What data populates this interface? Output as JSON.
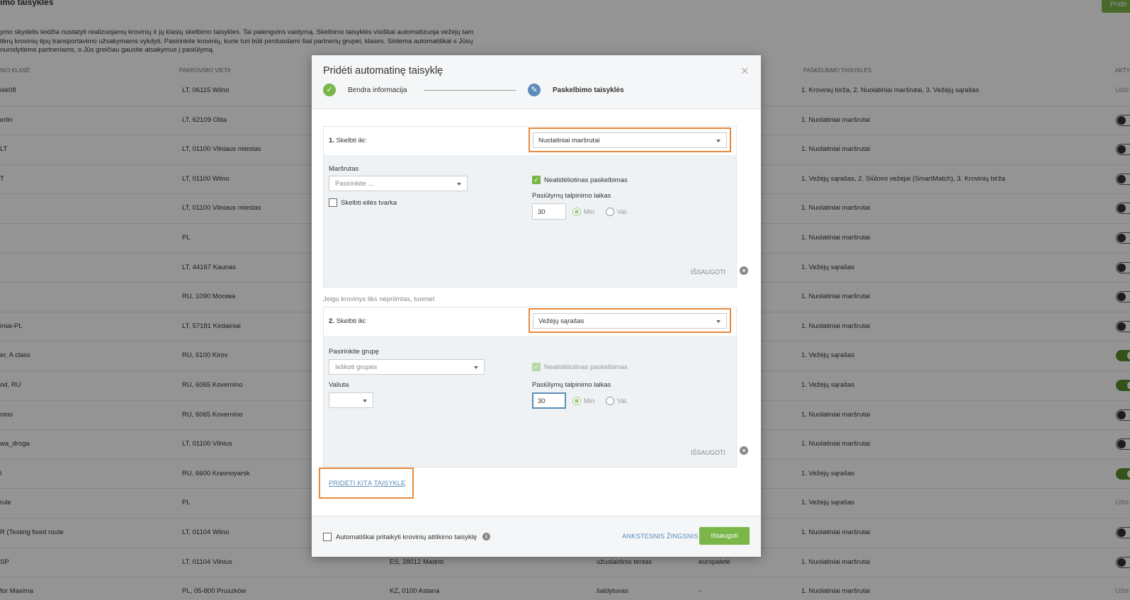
{
  "background": {
    "title": "imo taisyklės",
    "add_button": "Pridė",
    "description": "ymo skydelis leidžia nustatyti realizuojamų krovinių ir jų klasių skelbimo taisykles. Tai palengvins vaidymą. Skelbimo taisyklės visiškai automatizuoja vežėjų tam tikrų krovinių tipų transportavimo užsakymams vykdyti. Pasirinkite krovinių, kurie turi būti perduodami šiai partnerių grupei, klases. Sistema automatiškai s Jūsų nurodytiems partneriams, o Jūs greičiau gausite atsakymus į pasiūlymą.",
    "headers": {
      "class": "NIO KLASĖ",
      "loading": "PAKROVIMO VIETA",
      "rules": "PASKELBIMO TAISYKLĖS",
      "active": "AKTY"
    },
    "rows": [
      {
        "name": "iek08",
        "loading": "LT, 06115 Wilno",
        "unloading": "",
        "type": "",
        "pack": "",
        "rules": "1. Krovinių birža, 2. Nuolatiniai maršrutai, 3. Vežėjų sąrašas",
        "status": "Užbl"
      },
      {
        "name": "erlin",
        "loading": "LT, 62109 Olita",
        "unloading": "",
        "type": "",
        "pack": "",
        "rules": "1. Nuolatiniai maršrutai",
        "status": "toggle-off"
      },
      {
        "name": "LT",
        "loading": "LT, 01100 Vilniaus miestas",
        "unloading": "",
        "type": "",
        "pack": "",
        "rules": "1. Nuolatiniai maršrutai",
        "status": "toggle-off"
      },
      {
        "name": "T",
        "loading": "LT, 01100 Wilno",
        "unloading": "",
        "type": "",
        "pack": "",
        "rules": "1. Vežėjų sąrašas, 2. Siūlomi vežėjai (SmartMatch), 3. Krovinių birža",
        "status": "toggle-off"
      },
      {
        "name": "",
        "loading": "LT, 01100 Vilniaus miestas",
        "unloading": "",
        "type": "",
        "pack": "",
        "rules": "1. Nuolatiniai maršrutai",
        "status": "toggle-off"
      },
      {
        "name": "",
        "loading": "PL",
        "unloading": "",
        "type": "",
        "pack": "",
        "rules": "1. Nuolatiniai maršrutai",
        "status": "toggle-off"
      },
      {
        "name": "",
        "loading": "LT, 44167 Kaunas",
        "unloading": "",
        "type": "",
        "pack": "",
        "rules": "1. Vežėjų sąrašas",
        "status": "toggle-off"
      },
      {
        "name": "",
        "loading": "RU, 1090 Москва",
        "unloading": "",
        "type": "",
        "pack": "",
        "rules": "1. Nuolatiniai maršrutai",
        "status": "toggle-off"
      },
      {
        "name": "iniai-PL",
        "loading": "LT, 57181 Kėdainiai",
        "unloading": "",
        "type": "",
        "pack": "",
        "rules": "1. Nuolatiniai maršrutai",
        "status": "toggle-off"
      },
      {
        "name": "er, A class",
        "loading": "RU, 6100 Kirov",
        "unloading": "",
        "type": "",
        "pack": "",
        "rules": "1. Vežėjų sąrašas",
        "status": "toggle-on"
      },
      {
        "name": "od, RU",
        "loading": "RU, 6065 Kovernino",
        "unloading": "",
        "type": "",
        "pack": "",
        "rules": "1. Vežėjų sąrašas",
        "status": "toggle-on"
      },
      {
        "name": "nino",
        "loading": "RU, 6065 Kovernino",
        "unloading": "",
        "type": "",
        "pack": "",
        "rules": "1. Nuolatiniai maršrutai",
        "status": "toggle-off"
      },
      {
        "name": "wa_droga",
        "loading": "LT, 01100 Vilnius",
        "unloading": "",
        "type": "",
        "pack": "",
        "rules": "1. Nuolatiniai maršrutai",
        "status": "toggle-off"
      },
      {
        "name": "l",
        "loading": "RU, 6600 Krasnoyarsk",
        "unloading": "",
        "type": "",
        "pack": "",
        "rules": "1. Vežėjų sąrašas",
        "status": "toggle-on"
      },
      {
        "name": "rule",
        "loading": "PL",
        "unloading": "",
        "type": "",
        "pack": "",
        "rules": "1. Vežėjų sąrašas",
        "status": "Užbl"
      },
      {
        "name": "R (Testing fixed route",
        "loading": "LT, 01104 Wilno",
        "unloading": "",
        "type": "",
        "pack": "",
        "rules": "1. Nuolatiniai maršrutai",
        "status": "toggle-off"
      },
      {
        "name": "SP",
        "loading": "LT, 01104 Vilnius",
        "unloading": "ES, 28012 Madrid",
        "type": "užuolaidinis tentas",
        "pack": "europaletė",
        "rules": "1. Nuolatiniai maršrutai",
        "status": "toggle-off"
      },
      {
        "name": "for Maxima",
        "loading": "PL, 05-800 Pruszków",
        "unloading": "KZ, 0100 Astana",
        "type": "šaldytuvas",
        "pack": "-",
        "rules": "1. Nuolatiniai maršrutai",
        "status": "Užbl"
      }
    ]
  },
  "modal": {
    "title": "Pridėti automatinę taisyklę",
    "close": "×",
    "step1": {
      "icon": "✓",
      "label": "Bendra informacija"
    },
    "step2": {
      "icon": "✎",
      "label": "Paskelbimo taisyklės"
    },
    "rule1": {
      "number": "1.",
      "label": "Skelbti iki:",
      "select_value": "Nuolatiniai maršrutai",
      "route_label": "Maršrutas",
      "route_placeholder": "Pasirinkite ...",
      "order_checkbox_label": "Skelbti eilės tvarka",
      "order_checked": false,
      "instant_label": "Neatidėliotinas paskelbimas",
      "instant_checked": true,
      "time_label": "Pasiūlymų talpinimo laikas",
      "time_value": "30",
      "unit_min": "Min",
      "unit_val": "Val.",
      "save": "IŠSAUGOTI"
    },
    "separator": "Jeigu krovinys liks nepriimtas, tuomet",
    "rule2": {
      "number": "2.",
      "label": "Skelbti iki:",
      "select_value": "Vežėjų sąrašas",
      "group_label": "Pasirinkite grupę",
      "group_placeholder": "Ieškoti grupės",
      "currency_label": "Valiuta",
      "currency_value": "",
      "instant_label": "Neatidėliotinas paskelbimas",
      "instant_checked": true,
      "time_label": "Pasiūlymų talpinimo laikas",
      "time_value": "30",
      "unit_min": "Min",
      "unit_val": "Val.",
      "save": "IŠSAUGOTI"
    },
    "add_rule": "PRIDĖTI KITĄ TAISYKLĘ",
    "footer": {
      "auto_apply_label": "Automatiškai pritaikyti krovinių atitikimo taisyklę",
      "info_icon": "i",
      "prev_step": "ANKSTESNIS ŽINGSNIS",
      "save": "Išsaugoti"
    }
  },
  "colors": {
    "accent_green": "#7ab648",
    "accent_blue": "#5b8db8",
    "highlight_orange": "#e8893b",
    "toggle_on": "#5a8f2e"
  }
}
